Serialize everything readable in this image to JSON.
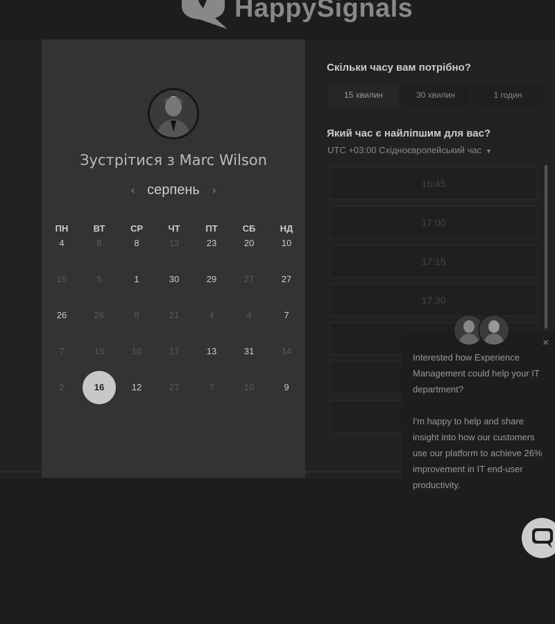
{
  "header": {
    "logo_text": "HappySignals"
  },
  "calendar": {
    "title": "Зустрітися з Marc Wilson",
    "month": "серпень",
    "prev_label": "‹",
    "next_label": "›",
    "weekdays": [
      "ПН",
      "ВТ",
      "СР",
      "ЧТ",
      "ПТ",
      "СБ",
      "НД"
    ],
    "rows": [
      [
        {
          "d": "4",
          "s": "active"
        },
        {
          "d": "8",
          "s": "muted"
        },
        {
          "d": "8",
          "s": "active"
        },
        {
          "d": "13",
          "s": "muted"
        },
        {
          "d": "23",
          "s": "active"
        },
        {
          "d": "20",
          "s": "active"
        },
        {
          "d": "10",
          "s": "active"
        }
      ],
      [
        {
          "d": "16",
          "s": "muted"
        },
        {
          "d": "5",
          "s": "muted"
        },
        {
          "d": "1",
          "s": "active"
        },
        {
          "d": "30",
          "s": "active"
        },
        {
          "d": "29",
          "s": "active"
        },
        {
          "d": "27",
          "s": "muted"
        },
        {
          "d": "27",
          "s": "active"
        }
      ],
      [
        {
          "d": "26",
          "s": "active"
        },
        {
          "d": "26",
          "s": "muted"
        },
        {
          "d": "8",
          "s": "muted"
        },
        {
          "d": "21",
          "s": "muted"
        },
        {
          "d": "4",
          "s": "muted"
        },
        {
          "d": "4",
          "s": "muted"
        },
        {
          "d": "7",
          "s": "active"
        }
      ],
      [
        {
          "d": "7",
          "s": "muted"
        },
        {
          "d": "15",
          "s": "muted"
        },
        {
          "d": "10",
          "s": "muted"
        },
        {
          "d": "17",
          "s": "muted"
        },
        {
          "d": "13",
          "s": "active"
        },
        {
          "d": "31",
          "s": "active"
        },
        {
          "d": "14",
          "s": "muted"
        }
      ],
      [
        {
          "d": "2",
          "s": "muted"
        },
        {
          "d": "16",
          "s": "selected"
        },
        {
          "d": "12",
          "s": "active"
        },
        {
          "d": "27",
          "s": "muted"
        },
        {
          "d": "7",
          "s": "muted"
        },
        {
          "d": "10",
          "s": "muted"
        },
        {
          "d": "9",
          "s": "active"
        }
      ]
    ]
  },
  "duration": {
    "title": "Скільки часу вам потрібно?",
    "options": [
      "15 хвилин",
      "30 хвилин",
      "1 годин"
    ],
    "selected_index": 0
  },
  "time": {
    "title": "Який час є найліпшим для вас?",
    "timezone": "UTC +03:00 Східноєвропейський час",
    "slots": [
      "16:45",
      "17:00",
      "17:15",
      "17:30",
      "",
      "",
      ""
    ]
  },
  "chat": {
    "close_label": "×",
    "line1": "Interested how Experience",
    "line2": "Management could help your IT",
    "line3": "department?",
    "line4": "I'm happy to help and share",
    "line5": "insight into how our customers",
    "line6": "use our platform to achieve 26%",
    "line7": "improvement in IT end-user",
    "line8": "productivity."
  },
  "colors": {
    "background": "#1d1d1d",
    "card": "#333333",
    "selected_day": "#c8c8c8"
  },
  "icons": {
    "logo": "speech-bubble-heart-icon",
    "chat": "chat-bubble-icon",
    "caret": "caret-down-icon",
    "close": "close-icon"
  }
}
